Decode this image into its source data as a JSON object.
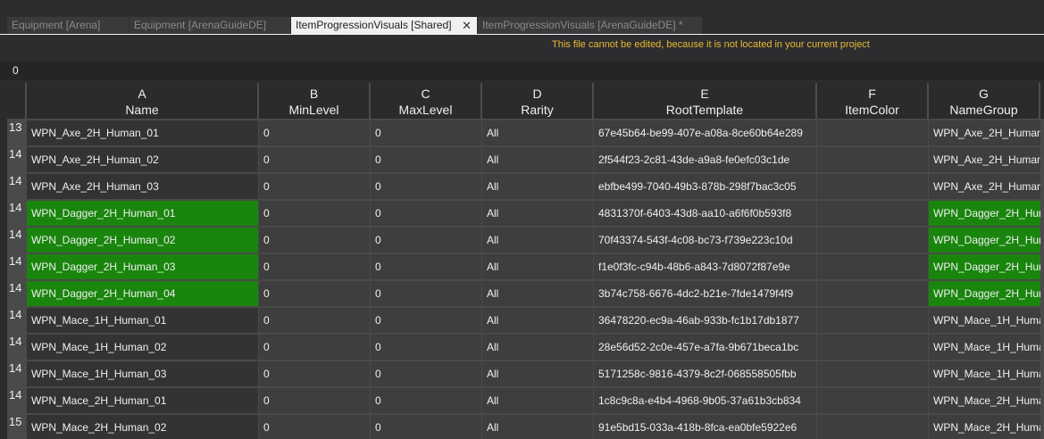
{
  "tabs": [
    {
      "label": "Equipment [Arena]",
      "active": false
    },
    {
      "label": "Equipment [ArenaGuideDE]",
      "active": false
    },
    {
      "label": "ItemProgressionVisuals [Shared]",
      "active": true,
      "close": "✕"
    },
    {
      "label": "ItemProgressionVisuals [ArenaGuideDE] *",
      "active": false
    }
  ],
  "notice": "This file cannot be edited, because it is not located in your current project",
  "formula_value": "0",
  "columns": [
    {
      "letter": "A",
      "name": "Name"
    },
    {
      "letter": "B",
      "name": "MinLevel"
    },
    {
      "letter": "C",
      "name": "MaxLevel"
    },
    {
      "letter": "D",
      "name": "Rarity"
    },
    {
      "letter": "E",
      "name": "RootTemplate"
    },
    {
      "letter": "F",
      "name": "ItemColor"
    },
    {
      "letter": "G",
      "name": "NameGroup"
    }
  ],
  "rows": [
    {
      "num": "13",
      "name": "WPN_Axe_2H_Human_01",
      "min": "0",
      "max": "0",
      "rarity": "All",
      "root": "67e45b64-be99-407e-a08a-8ce60b64e289",
      "color": "",
      "group": "WPN_Axe_2H_Human_",
      "hl": false
    },
    {
      "num": "14",
      "name": "WPN_Axe_2H_Human_02",
      "min": "0",
      "max": "0",
      "rarity": "All",
      "root": "2f544f23-2c81-43de-a9a8-fe0efc03c1de",
      "color": "",
      "group": "WPN_Axe_2H_Human_",
      "hl": false
    },
    {
      "num": "14",
      "name": "WPN_Axe_2H_Human_03",
      "min": "0",
      "max": "0",
      "rarity": "All",
      "root": "ebfbe499-7040-49b3-878b-298f7bac3c05",
      "color": "",
      "group": "WPN_Axe_2H_Human_",
      "hl": false
    },
    {
      "num": "14",
      "name": "WPN_Dagger_2H_Human_01",
      "min": "0",
      "max": "0",
      "rarity": "All",
      "root": "4831370f-6403-43d8-aa10-a6f6f0b593f8",
      "color": "",
      "group": "WPN_Dagger_2H_Hun",
      "hl": true
    },
    {
      "num": "14",
      "name": "WPN_Dagger_2H_Human_02",
      "min": "0",
      "max": "0",
      "rarity": "All",
      "root": "70f43374-543f-4c08-bc73-f739e223c10d",
      "color": "",
      "group": "WPN_Dagger_2H_Hun",
      "hl": true
    },
    {
      "num": "14",
      "name": "WPN_Dagger_2H_Human_03",
      "min": "0",
      "max": "0",
      "rarity": "All",
      "root": "f1e0f3fc-c94b-48b6-a843-7d8072f87e9e",
      "color": "",
      "group": "WPN_Dagger_2H_Hun",
      "hl": true
    },
    {
      "num": "14",
      "name": "WPN_Dagger_2H_Human_04",
      "min": "0",
      "max": "0",
      "rarity": "All",
      "root": "3b74c758-6676-4dc2-b21e-7fde1479f4f9",
      "color": "",
      "group": "WPN_Dagger_2H_Hun",
      "hl": true
    },
    {
      "num": "14",
      "name": "WPN_Mace_1H_Human_01",
      "min": "0",
      "max": "0",
      "rarity": "All",
      "root": "36478220-ec9a-46ab-933b-fc1b17db1877",
      "color": "",
      "group": "WPN_Mace_1H_Huma",
      "hl": false
    },
    {
      "num": "14",
      "name": "WPN_Mace_1H_Human_02",
      "min": "0",
      "max": "0",
      "rarity": "All",
      "root": "28e56d52-2c0e-457e-a7fa-9b671beca1bc",
      "color": "",
      "group": "WPN_Mace_1H_Huma",
      "hl": false
    },
    {
      "num": "14",
      "name": "WPN_Mace_1H_Human_03",
      "min": "0",
      "max": "0",
      "rarity": "All",
      "root": "5171258c-9816-4379-8c2f-068558505fbb",
      "color": "",
      "group": "WPN_Mace_1H_Huma",
      "hl": false
    },
    {
      "num": "14",
      "name": "WPN_Mace_2H_Human_01",
      "min": "0",
      "max": "0",
      "rarity": "All",
      "root": "1c8c9c8a-e4b4-4968-9b05-37a61b3cb834",
      "color": "",
      "group": "WPN_Mace_2H_Huma",
      "hl": false
    },
    {
      "num": "15",
      "name": "WPN_Mace_2H_Human_02",
      "min": "0",
      "max": "0",
      "rarity": "All",
      "root": "91e5bd15-033a-418b-8fca-ea0bfe5922e6",
      "color": "",
      "group": "WPN_Mace_2H_Huma",
      "hl": false
    }
  ],
  "colors": {
    "highlight": "#19850d",
    "notice": "#e8b92f",
    "active_tab": "#f0f0f0"
  }
}
